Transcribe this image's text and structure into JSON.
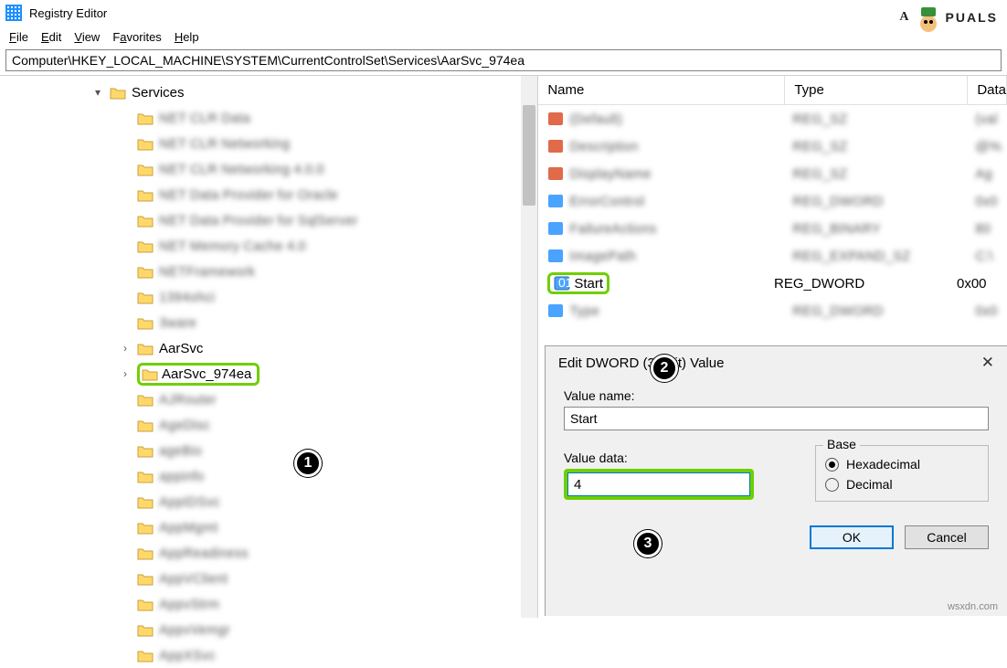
{
  "window": {
    "title": "Registry Editor"
  },
  "menu": {
    "file": "File",
    "edit": "Edit",
    "view": "View",
    "favorites": "Favorites",
    "help": "Help"
  },
  "address": "Computer\\HKEY_LOCAL_MACHINE\\SYSTEM\\CurrentControlSet\\Services\\AarSvc_974ea",
  "tree": {
    "root": "Services",
    "blurred": [
      "NET CLR Data",
      "NET CLR Networking",
      "NET CLR Networking 4.0.0",
      "NET Data Provider for Oracle",
      "NET Data Provider for SqlServer",
      "NET Memory Cache 4.0",
      "NETFramework",
      "1394ohci",
      "3ware"
    ],
    "item_aarsvc": "AarSvc",
    "item_selected": "AarSvc_974ea",
    "blurred_after": [
      "AJRouter",
      "AgeDisc",
      "ageBio",
      "appinfo",
      "AppIDSvc",
      "AppMgmt",
      "AppReadiness",
      "AppVClient",
      "AppvStrm",
      "AppvVemgr",
      "AppXSvc"
    ]
  },
  "columns": {
    "name": "Name",
    "type": "Type",
    "data": "Data"
  },
  "values": {
    "blurred_before": [
      {
        "n": "(Default)",
        "t": "REG_SZ",
        "d": "(val"
      },
      {
        "n": "Description",
        "t": "REG_SZ",
        "d": "@%"
      },
      {
        "n": "DisplayName",
        "t": "REG_SZ",
        "d": "Ag"
      },
      {
        "n": "ErrorControl",
        "t": "REG_DWORD",
        "d": "0x0"
      },
      {
        "n": "FailureActions",
        "t": "REG_BINARY",
        "d": "80"
      },
      {
        "n": "ImagePath",
        "t": "REG_EXPAND_SZ",
        "d": "C:\\"
      }
    ],
    "start": {
      "name": "Start",
      "type": "REG_DWORD",
      "data": "0x00"
    },
    "blurred_after": [
      {
        "n": "Type",
        "t": "REG_DWORD",
        "d": "0x0"
      }
    ]
  },
  "dialog": {
    "title": "Edit DWORD (32-bit) Value",
    "value_name_label": "Value name:",
    "value_name": "Start",
    "value_data_label": "Value data:",
    "value_data": "4",
    "base_label": "Base",
    "hex": "Hexadecimal",
    "dec": "Decimal",
    "ok": "OK",
    "cancel": "Cancel"
  },
  "callouts": {
    "one": "1",
    "two": "2",
    "three": "3"
  },
  "branding": {
    "appuals": "A   PUALS",
    "wm": "wsxdn.com"
  }
}
